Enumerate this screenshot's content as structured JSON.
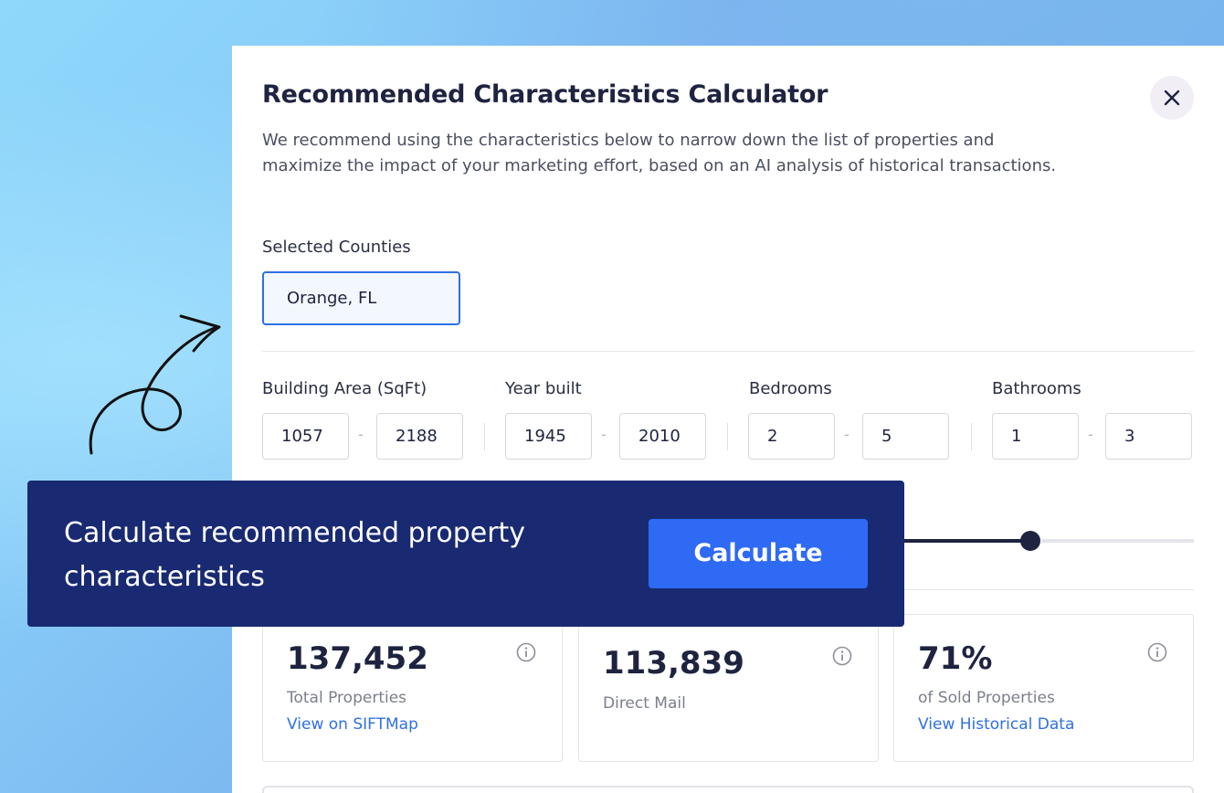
{
  "modal": {
    "title": "Recommended Characteristics Calculator",
    "description": "We recommend using the characteristics below to narrow down the list of properties and maximize the impact of your marketing effort, based on an AI analysis of historical transactions.",
    "close_icon": "close-icon"
  },
  "counties": {
    "label": "Selected Counties",
    "value": "Orange, FL"
  },
  "filters": {
    "building_area": {
      "label": "Building Area (SqFt)",
      "min": "1057",
      "max": "2188"
    },
    "year_built": {
      "label": "Year built",
      "min": "1945",
      "max": "2010"
    },
    "bedrooms": {
      "label": "Bedrooms",
      "min": "2",
      "max": "5"
    },
    "bathrooms": {
      "label": "Bathrooms",
      "min": "1",
      "max": "3"
    },
    "separator": "-"
  },
  "stats": [
    {
      "value": "137,452",
      "label": "Total Properties",
      "link": "View on SIFTMap",
      "icon": "info-icon"
    },
    {
      "value": "113,839",
      "label": "Direct Mail",
      "icon": "info-icon"
    },
    {
      "value": "71%",
      "label": "of Sold Properties",
      "link": "View Historical Data",
      "icon": "info-icon"
    }
  ],
  "callout": {
    "text": "Calculate recommended property characteristics",
    "button": "Calculate",
    "arrow_icon": "curly-arrow-icon"
  },
  "colors": {
    "navy": "#192a72",
    "accent_blue": "#2e6af3",
    "link_blue": "#2f6fe8"
  }
}
